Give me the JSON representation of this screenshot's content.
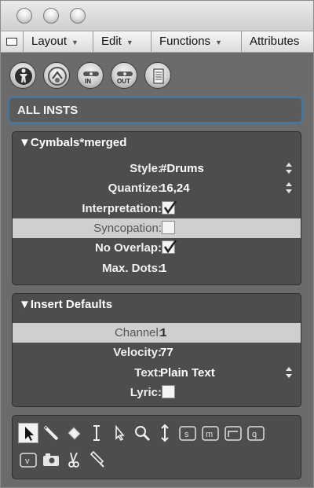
{
  "window": {
    "controls": [
      "close-button",
      "minimize-button",
      "zoom-button"
    ]
  },
  "menubar": {
    "items": [
      {
        "label": "Layout"
      },
      {
        "label": "Edit"
      },
      {
        "label": "Functions"
      },
      {
        "label": "Attributes"
      }
    ]
  },
  "toolbar": {
    "buttons": [
      {
        "icon": "person-icon"
      },
      {
        "icon": "drum-icon"
      },
      {
        "icon": "midi-in-icon",
        "label": "IN"
      },
      {
        "icon": "midi-out-icon",
        "label": "OUT"
      },
      {
        "icon": "notepad-icon"
      }
    ]
  },
  "display_parameter": {
    "value": "ALL INSTS"
  },
  "staff_style": {
    "title": "Cymbals*merged",
    "rows": [
      {
        "label": "Style:",
        "value": "#Drums"
      },
      {
        "label": "Quantize:",
        "value": "16,24"
      },
      {
        "label": "Interpretation:",
        "checked": true
      },
      {
        "label": "Syncopation:",
        "checked": false
      },
      {
        "label": "No Overlap:",
        "checked": true
      },
      {
        "label": "Max. Dots:",
        "value": "1"
      }
    ]
  },
  "insert_defaults": {
    "title": "Insert Defaults",
    "rows": [
      {
        "label": "Channel:",
        "value": "1"
      },
      {
        "label": "Velocity:",
        "value": "77"
      },
      {
        "label": "Text:",
        "value": "Plain Text"
      },
      {
        "label": "Lyric:",
        "checked": false
      }
    ]
  },
  "tools": {
    "row1": [
      "pointer-icon",
      "pencil-icon",
      "eraser-icon",
      "text-cursor-icon",
      "arrow-icon",
      "magnifier-icon",
      "resize-icon",
      "s-box-icon",
      "m-box-icon",
      "quantize-box-icon",
      "q-box-icon"
    ],
    "row2": [
      "v-box-icon",
      "camera-icon",
      "scissors-icon",
      "glue-icon"
    ]
  }
}
